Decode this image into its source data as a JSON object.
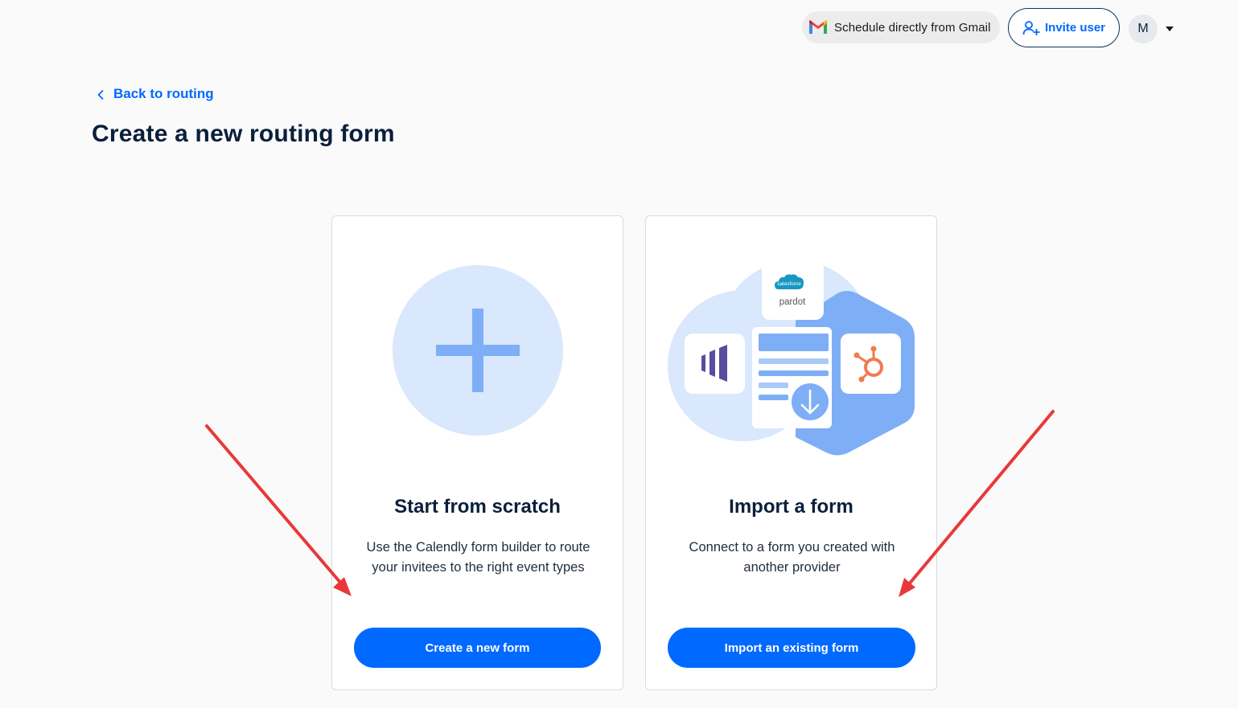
{
  "topbar": {
    "gmail_label": "Schedule directly from Gmail",
    "gmail_icon": "gmail-icon",
    "invite_label": "Invite user",
    "invite_icon": "add-user-icon",
    "avatar_initial": "M",
    "avatar_caret_icon": "caret-down-icon"
  },
  "back_link": {
    "label": "Back to routing",
    "icon": "chevron-left-icon"
  },
  "page_title": "Create a new routing form",
  "cards": [
    {
      "title": "Start from scratch",
      "description": "Use the Calendly form builder to route your invitees to the right event types",
      "button_label": "Create a new form",
      "illustration_icon": "plus-icon"
    },
    {
      "title": "Import a form",
      "description": "Connect to a form you created with another provider",
      "button_label": "Import an existing form",
      "illustration_icon": "form-import-icon",
      "provider_logos": {
        "salesforce_text": "salesforce",
        "pardot_text": "pardot",
        "marketo_icon": "marketo-icon",
        "hubspot_icon": "hubspot-icon",
        "download_icon": "download-arrow-icon"
      }
    }
  ],
  "colors": {
    "primary": "#0069ff",
    "title": "#0b1f3a",
    "background": "#fafafa",
    "annotation_arrow": "#e8393a",
    "illustration_light_blue": "#d9e8fc",
    "illustration_blue": "#7eaef5",
    "hubspot_orange": "#ef7b51",
    "marketo_purple": "#5c4c9f",
    "salesforce_blue": "#1798c1"
  }
}
